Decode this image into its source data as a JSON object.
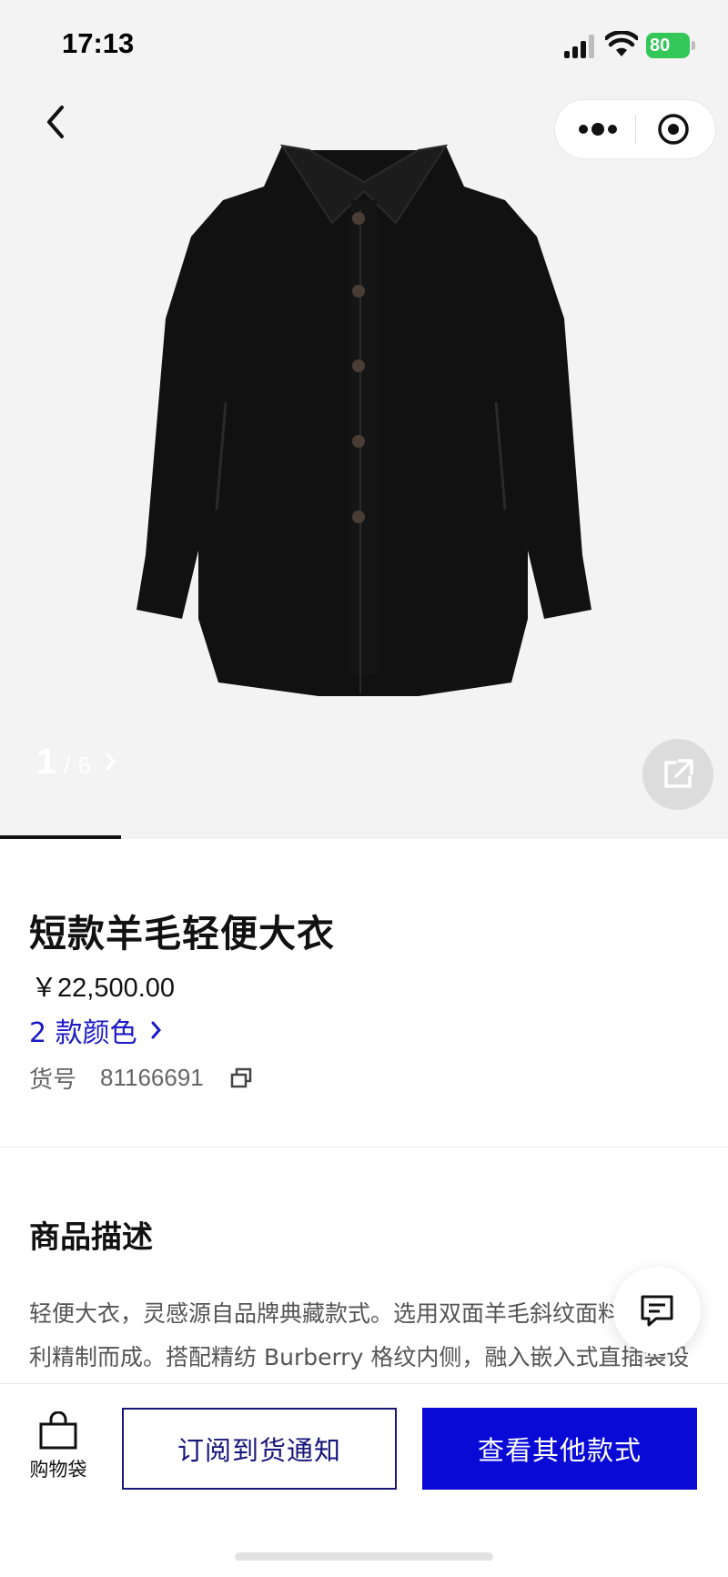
{
  "status_bar": {
    "time": "17:13",
    "battery": "80"
  },
  "gallery": {
    "current": "1",
    "separator": "/",
    "total": "6",
    "progress": 0.166
  },
  "product": {
    "title": "短款羊毛轻便大衣",
    "price": "￥22,500.00",
    "colors_link": "2 款颜色",
    "sku_label": "货号",
    "sku_value": "81166691"
  },
  "description": {
    "heading": "商品描述",
    "text": "轻便大衣，灵感源自品牌典藏款式。选用双面羊毛斜纹面料，意大利精制而成。搭配精纺 Burberry 格纹内侧，融入嵌入式直插袋设计，呈现修身版型，配搭短大衣，贴边侧袋，后开衩，暗门襟。"
  },
  "bottom_bar": {
    "bag_label": "购物袋",
    "notify_label": "订阅到货通知",
    "other_label": "查看其他款式"
  },
  "colors": {
    "accent": "#0a0ad6",
    "accent_dark": "#15157a",
    "link": "#1a1ac6"
  }
}
